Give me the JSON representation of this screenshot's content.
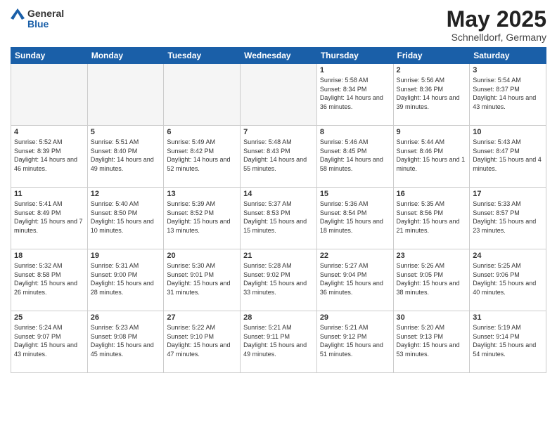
{
  "header": {
    "logo_general": "General",
    "logo_blue": "Blue",
    "title": "May 2025",
    "subtitle": "Schnelldorf, Germany"
  },
  "days_of_week": [
    "Sunday",
    "Monday",
    "Tuesday",
    "Wednesday",
    "Thursday",
    "Friday",
    "Saturday"
  ],
  "weeks": [
    [
      {
        "day": "",
        "empty": true
      },
      {
        "day": "",
        "empty": true
      },
      {
        "day": "",
        "empty": true
      },
      {
        "day": "",
        "empty": true
      },
      {
        "day": "1",
        "sunrise": "5:58 AM",
        "sunset": "8:34 PM",
        "daylight": "14 hours and 36 minutes."
      },
      {
        "day": "2",
        "sunrise": "5:56 AM",
        "sunset": "8:36 PM",
        "daylight": "14 hours and 39 minutes."
      },
      {
        "day": "3",
        "sunrise": "5:54 AM",
        "sunset": "8:37 PM",
        "daylight": "14 hours and 43 minutes."
      }
    ],
    [
      {
        "day": "4",
        "sunrise": "5:52 AM",
        "sunset": "8:39 PM",
        "daylight": "14 hours and 46 minutes."
      },
      {
        "day": "5",
        "sunrise": "5:51 AM",
        "sunset": "8:40 PM",
        "daylight": "14 hours and 49 minutes."
      },
      {
        "day": "6",
        "sunrise": "5:49 AM",
        "sunset": "8:42 PM",
        "daylight": "14 hours and 52 minutes."
      },
      {
        "day": "7",
        "sunrise": "5:48 AM",
        "sunset": "8:43 PM",
        "daylight": "14 hours and 55 minutes."
      },
      {
        "day": "8",
        "sunrise": "5:46 AM",
        "sunset": "8:45 PM",
        "daylight": "14 hours and 58 minutes."
      },
      {
        "day": "9",
        "sunrise": "5:44 AM",
        "sunset": "8:46 PM",
        "daylight": "15 hours and 1 minute."
      },
      {
        "day": "10",
        "sunrise": "5:43 AM",
        "sunset": "8:47 PM",
        "daylight": "15 hours and 4 minutes."
      }
    ],
    [
      {
        "day": "11",
        "sunrise": "5:41 AM",
        "sunset": "8:49 PM",
        "daylight": "15 hours and 7 minutes."
      },
      {
        "day": "12",
        "sunrise": "5:40 AM",
        "sunset": "8:50 PM",
        "daylight": "15 hours and 10 minutes."
      },
      {
        "day": "13",
        "sunrise": "5:39 AM",
        "sunset": "8:52 PM",
        "daylight": "15 hours and 13 minutes."
      },
      {
        "day": "14",
        "sunrise": "5:37 AM",
        "sunset": "8:53 PM",
        "daylight": "15 hours and 15 minutes."
      },
      {
        "day": "15",
        "sunrise": "5:36 AM",
        "sunset": "8:54 PM",
        "daylight": "15 hours and 18 minutes."
      },
      {
        "day": "16",
        "sunrise": "5:35 AM",
        "sunset": "8:56 PM",
        "daylight": "15 hours and 21 minutes."
      },
      {
        "day": "17",
        "sunrise": "5:33 AM",
        "sunset": "8:57 PM",
        "daylight": "15 hours and 23 minutes."
      }
    ],
    [
      {
        "day": "18",
        "sunrise": "5:32 AM",
        "sunset": "8:58 PM",
        "daylight": "15 hours and 26 minutes."
      },
      {
        "day": "19",
        "sunrise": "5:31 AM",
        "sunset": "9:00 PM",
        "daylight": "15 hours and 28 minutes."
      },
      {
        "day": "20",
        "sunrise": "5:30 AM",
        "sunset": "9:01 PM",
        "daylight": "15 hours and 31 minutes."
      },
      {
        "day": "21",
        "sunrise": "5:28 AM",
        "sunset": "9:02 PM",
        "daylight": "15 hours and 33 minutes."
      },
      {
        "day": "22",
        "sunrise": "5:27 AM",
        "sunset": "9:04 PM",
        "daylight": "15 hours and 36 minutes."
      },
      {
        "day": "23",
        "sunrise": "5:26 AM",
        "sunset": "9:05 PM",
        "daylight": "15 hours and 38 minutes."
      },
      {
        "day": "24",
        "sunrise": "5:25 AM",
        "sunset": "9:06 PM",
        "daylight": "15 hours and 40 minutes."
      }
    ],
    [
      {
        "day": "25",
        "sunrise": "5:24 AM",
        "sunset": "9:07 PM",
        "daylight": "15 hours and 43 minutes."
      },
      {
        "day": "26",
        "sunrise": "5:23 AM",
        "sunset": "9:08 PM",
        "daylight": "15 hours and 45 minutes."
      },
      {
        "day": "27",
        "sunrise": "5:22 AM",
        "sunset": "9:10 PM",
        "daylight": "15 hours and 47 minutes."
      },
      {
        "day": "28",
        "sunrise": "5:21 AM",
        "sunset": "9:11 PM",
        "daylight": "15 hours and 49 minutes."
      },
      {
        "day": "29",
        "sunrise": "5:21 AM",
        "sunset": "9:12 PM",
        "daylight": "15 hours and 51 minutes."
      },
      {
        "day": "30",
        "sunrise": "5:20 AM",
        "sunset": "9:13 PM",
        "daylight": "15 hours and 53 minutes."
      },
      {
        "day": "31",
        "sunrise": "5:19 AM",
        "sunset": "9:14 PM",
        "daylight": "15 hours and 54 minutes."
      }
    ]
  ]
}
